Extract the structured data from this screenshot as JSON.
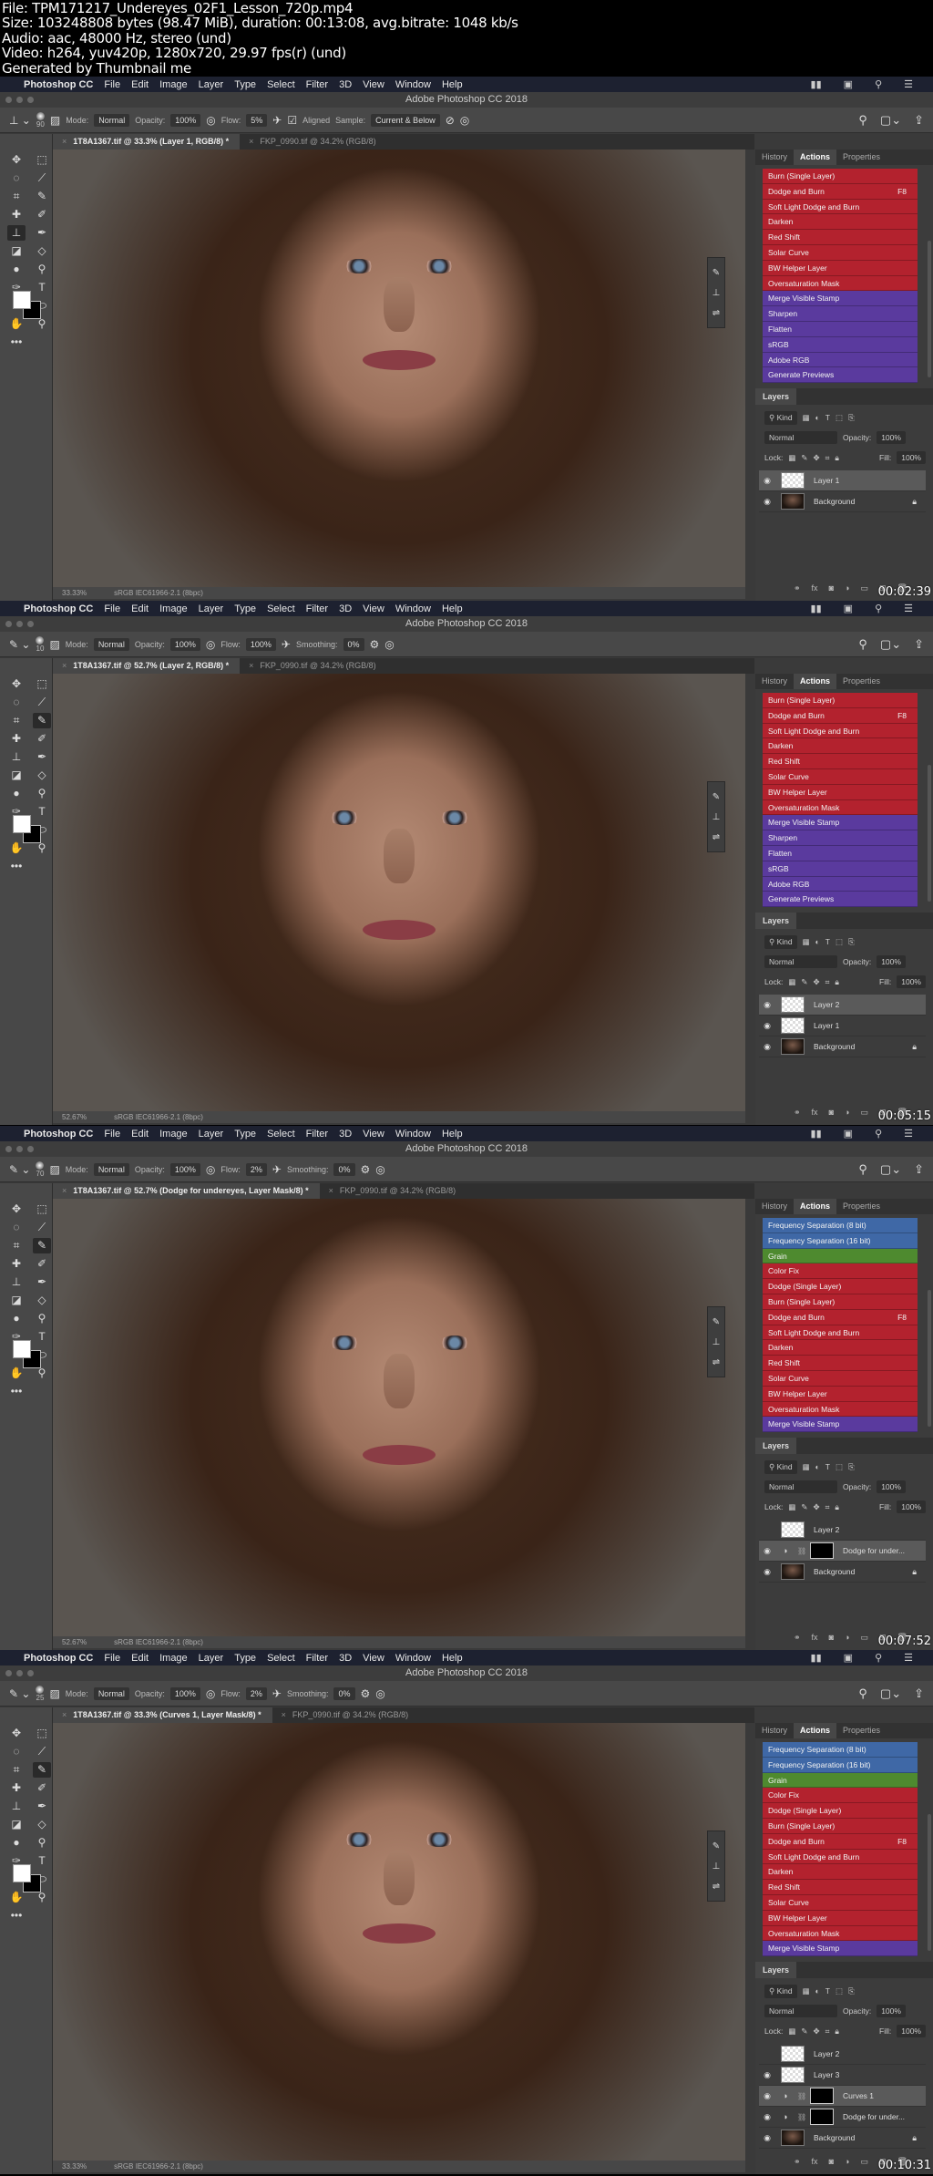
{
  "file_info": [
    "File: TPM171217_Undereyes_02F1_Lesson_720p.mp4",
    "Size: 103248808 bytes (98.47 MiB), duration: 00:13:08, avg.bitrate: 1048 kb/s",
    "Audio: aac, 48000 Hz, stereo (und)",
    "Video: h264, yuv420p, 1280x720, 29.97 fps(r) (und)",
    "Generated by Thumbnail me"
  ],
  "menu": {
    "app": "Photoshop CC",
    "items": [
      "File",
      "Edit",
      "Image",
      "Layer",
      "Type",
      "Select",
      "Filter",
      "3D",
      "View",
      "Window",
      "Help"
    ]
  },
  "window_title": "Adobe Photoshop CC 2018",
  "panel_tabs": [
    "History",
    "Actions",
    "Properties"
  ],
  "layers_title": "Layers",
  "layers_controls": {
    "kind": "Kind",
    "blend": "Normal",
    "opacity_label": "Opacity:",
    "opacity": "100%",
    "lock_label": "Lock:",
    "fill_label": "Fill:",
    "fill": "100%"
  },
  "status_profile": "sRGB IEC61966-2.1 (8bpc)",
  "colors": {
    "red": "#b3222e",
    "purple": "#5a3a9e",
    "blue": "#3f68a6",
    "green": "#4e8a2f"
  },
  "frames": [
    {
      "timestamp": "00:02:39",
      "zoom": "33.33%",
      "options": {
        "tool": "clone-stamp",
        "size": "90",
        "mode_label": "Mode:",
        "mode": "Normal",
        "opacity_label": "Opacity:",
        "opacity": "100%",
        "flow_label": "Flow:",
        "flow": "5%",
        "aligned": "Aligned",
        "sample_label": "Sample:",
        "sample": "Current & Below"
      },
      "tabs": [
        "1T8A1367.tif @ 33.3% (Layer 1, RGB/8) *",
        "FKP_0990.tif @ 34.2% (RGB/8)"
      ],
      "actions": [
        {
          "label": "Burn (Single Layer)",
          "color": "red"
        },
        {
          "label": "Dodge and Burn",
          "key": "F8",
          "color": "red"
        },
        {
          "label": "Soft Light Dodge and Burn",
          "color": "red"
        },
        {
          "label": "Darken",
          "color": "red"
        },
        {
          "label": "Red Shift",
          "color": "red"
        },
        {
          "label": "Solar Curve",
          "color": "red"
        },
        {
          "label": "BW Helper Layer",
          "color": "red"
        },
        {
          "label": "Oversaturation Mask",
          "color": "red"
        },
        {
          "label": "Merge Visible Stamp",
          "color": "purple"
        },
        {
          "label": "Sharpen",
          "color": "purple"
        },
        {
          "label": "Flatten",
          "color": "purple"
        },
        {
          "label": "sRGB",
          "color": "purple"
        },
        {
          "label": "Adobe RGB",
          "color": "purple"
        },
        {
          "label": "Generate Previews",
          "color": "purple"
        }
      ],
      "layers": [
        {
          "name": "Layer 1",
          "visible": true,
          "thumb": "tr",
          "selected": true
        },
        {
          "name": "Background",
          "visible": true,
          "thumb": "ph",
          "locked": true
        }
      ]
    },
    {
      "timestamp": "00:05:15",
      "zoom": "52.67%",
      "options": {
        "tool": "brush",
        "size": "10",
        "mode_label": "Mode:",
        "mode": "Normal",
        "opacity_label": "Opacity:",
        "opacity": "100%",
        "flow_label": "Flow:",
        "flow": "100%",
        "smoothing_label": "Smoothing:",
        "smoothing": "0%"
      },
      "tabs": [
        "1T8A1367.tif @ 52.7% (Layer 2, RGB/8) *",
        "FKP_0990.tif @ 34.2% (RGB/8)"
      ],
      "actions": [
        {
          "label": "Burn (Single Layer)",
          "color": "red"
        },
        {
          "label": "Dodge and Burn",
          "key": "F8",
          "color": "red"
        },
        {
          "label": "Soft Light Dodge and Burn",
          "color": "red"
        },
        {
          "label": "Darken",
          "color": "red"
        },
        {
          "label": "Red Shift",
          "color": "red"
        },
        {
          "label": "Solar Curve",
          "color": "red"
        },
        {
          "label": "BW Helper Layer",
          "color": "red"
        },
        {
          "label": "Oversaturation Mask",
          "color": "red"
        },
        {
          "label": "Merge Visible Stamp",
          "color": "purple"
        },
        {
          "label": "Sharpen",
          "color": "purple"
        },
        {
          "label": "Flatten",
          "color": "purple"
        },
        {
          "label": "sRGB",
          "color": "purple"
        },
        {
          "label": "Adobe RGB",
          "color": "purple"
        },
        {
          "label": "Generate Previews",
          "color": "purple"
        }
      ],
      "layers": [
        {
          "name": "Layer 2",
          "visible": true,
          "thumb": "tr",
          "selected": true
        },
        {
          "name": "Layer 1",
          "visible": true,
          "thumb": "tr"
        },
        {
          "name": "Background",
          "visible": true,
          "thumb": "ph",
          "locked": true
        }
      ]
    },
    {
      "timestamp": "00:07:52",
      "zoom": "52.67%",
      "options": {
        "tool": "brush",
        "size": "70",
        "mode_label": "Mode:",
        "mode": "Normal",
        "opacity_label": "Opacity:",
        "opacity": "100%",
        "flow_label": "Flow:",
        "flow": "2%",
        "smoothing_label": "Smoothing:",
        "smoothing": "0%"
      },
      "tabs": [
        "1T8A1367.tif @ 52.7% (Dodge for undereyes, Layer Mask/8) *",
        "FKP_0990.tif @ 34.2% (RGB/8)"
      ],
      "actions": [
        {
          "label": "Frequency Separation (8 bit)",
          "color": "blue"
        },
        {
          "label": "Frequency Separation (16 bit)",
          "color": "blue"
        },
        {
          "label": "Grain",
          "color": "green"
        },
        {
          "label": "Color Fix",
          "color": "red"
        },
        {
          "label": "Dodge (Single Layer)",
          "color": "red"
        },
        {
          "label": "Burn (Single Layer)",
          "color": "red"
        },
        {
          "label": "Dodge and Burn",
          "key": "F8",
          "color": "red"
        },
        {
          "label": "Soft Light Dodge and Burn",
          "color": "red"
        },
        {
          "label": "Darken",
          "color": "red"
        },
        {
          "label": "Red Shift",
          "color": "red"
        },
        {
          "label": "Solar Curve",
          "color": "red"
        },
        {
          "label": "BW Helper Layer",
          "color": "red"
        },
        {
          "label": "Oversaturation Mask",
          "color": "red"
        },
        {
          "label": "Merge Visible Stamp",
          "color": "purple"
        }
      ],
      "layers": [
        {
          "name": "Layer 2",
          "visible": false,
          "thumb": "tr"
        },
        {
          "name": "Dodge for under...",
          "visible": true,
          "thumb": "mk",
          "adjustment": true,
          "selected": true
        },
        {
          "name": "Background",
          "visible": true,
          "thumb": "ph",
          "locked": true
        }
      ]
    },
    {
      "timestamp": "00:10:31",
      "zoom": "33.33%",
      "options": {
        "tool": "brush",
        "size": "25",
        "mode_label": "Mode:",
        "mode": "Normal",
        "opacity_label": "Opacity:",
        "opacity": "100%",
        "flow_label": "Flow:",
        "flow": "2%",
        "smoothing_label": "Smoothing:",
        "smoothing": "0%"
      },
      "tabs": [
        "1T8A1367.tif @ 33.3% (Curves 1, Layer Mask/8) *",
        "FKP_0990.tif @ 34.2% (RGB/8)"
      ],
      "actions": [
        {
          "label": "Frequency Separation (8 bit)",
          "color": "blue"
        },
        {
          "label": "Frequency Separation (16 bit)",
          "color": "blue"
        },
        {
          "label": "Grain",
          "color": "green"
        },
        {
          "label": "Color Fix",
          "color": "red"
        },
        {
          "label": "Dodge (Single Layer)",
          "color": "red"
        },
        {
          "label": "Burn (Single Layer)",
          "color": "red"
        },
        {
          "label": "Dodge and Burn",
          "key": "F8",
          "color": "red"
        },
        {
          "label": "Soft Light Dodge and Burn",
          "color": "red"
        },
        {
          "label": "Darken",
          "color": "red"
        },
        {
          "label": "Red Shift",
          "color": "red"
        },
        {
          "label": "Solar Curve",
          "color": "red"
        },
        {
          "label": "BW Helper Layer",
          "color": "red"
        },
        {
          "label": "Oversaturation Mask",
          "color": "red"
        },
        {
          "label": "Merge Visible Stamp",
          "color": "purple"
        }
      ],
      "layers": [
        {
          "name": "Layer 2",
          "visible": false,
          "thumb": "tr"
        },
        {
          "name": "Layer 3",
          "visible": true,
          "thumb": "tr"
        },
        {
          "name": "Curves 1",
          "visible": true,
          "thumb": "mk",
          "adjustment": true,
          "selected": true
        },
        {
          "name": "Dodge for under...",
          "visible": true,
          "thumb": "mk",
          "adjustment": true
        },
        {
          "name": "Background",
          "visible": true,
          "thumb": "ph",
          "locked": true
        }
      ]
    }
  ]
}
